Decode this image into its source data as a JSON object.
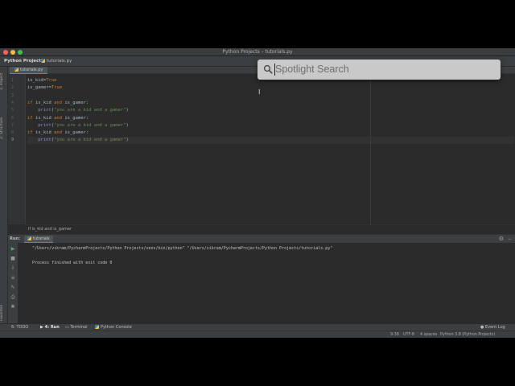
{
  "window": {
    "title": "Python Projects – tutorials.py",
    "traffic_colors": [
      "#fc615d",
      "#fdbc40",
      "#34c84a"
    ]
  },
  "navbar": {
    "project": "Python Projects",
    "file": "tutorials.py"
  },
  "left_strip": {
    "project_label": "1: Project",
    "structure_label": "Z: Structure",
    "favorites_label": "2: Favorites"
  },
  "editor": {
    "tab_label": "tutorials.py",
    "line_numbers": [
      "1",
      "2",
      "3",
      "4",
      "5",
      "6",
      "7",
      "8",
      "9"
    ],
    "current_line": 9,
    "lines": [
      [
        {
          "t": "is_kid=",
          "c": "plain"
        },
        {
          "t": "True",
          "c": "kw"
        }
      ],
      [
        {
          "t": "is_gamer=",
          "c": "plain"
        },
        {
          "t": "True",
          "c": "kw"
        }
      ],
      [],
      [
        {
          "t": "if ",
          "c": "kw"
        },
        {
          "t": "is_kid ",
          "c": "plain"
        },
        {
          "t": "and ",
          "c": "kw"
        },
        {
          "t": "is_gamer:",
          "c": "plain"
        }
      ],
      [
        {
          "t": "    ",
          "c": "plain"
        },
        {
          "t": "print",
          "c": "fn"
        },
        {
          "t": "(",
          "c": "plain"
        },
        {
          "t": "\"you are a kid and a gamer\"",
          "c": "st"
        },
        {
          "t": ")",
          "c": "plain"
        }
      ],
      [
        {
          "t": "if ",
          "c": "kw"
        },
        {
          "t": "is_kid ",
          "c": "plain"
        },
        {
          "t": "and ",
          "c": "kw"
        },
        {
          "t": "is_gamer:",
          "c": "plain"
        }
      ],
      [
        {
          "t": "    ",
          "c": "plain"
        },
        {
          "t": "print",
          "c": "fn"
        },
        {
          "t": "(",
          "c": "plain"
        },
        {
          "t": "\"you are a kid and a gamer\"",
          "c": "st"
        },
        {
          "t": ")",
          "c": "plain"
        }
      ],
      [
        {
          "t": "if ",
          "c": "kw"
        },
        {
          "t": "is_kid ",
          "c": "plain"
        },
        {
          "t": "and ",
          "c": "kw"
        },
        {
          "t": "is_gamer:",
          "c": "plain"
        }
      ],
      [
        {
          "t": "    ",
          "c": "plain"
        },
        {
          "t": "print",
          "c": "fn"
        },
        {
          "t": "(",
          "c": "plain"
        },
        {
          "t": "\"you are a kid and a gamer\"",
          "c": "st"
        },
        {
          "t": ")",
          "c": "plain"
        }
      ]
    ],
    "breadcrumb": "if is_kid and is_gamer"
  },
  "run_panel": {
    "label": "Run:",
    "tab": "tutorials",
    "command": "\"/Users/vikram/PycharmProjects/Python Projects/venv/bin/python\" \"/Users/vikram/PycharmProjects/Python Projects/tutorials.py\"",
    "result": "Process finished with exit code 0"
  },
  "bottom_tabs": {
    "todo": "6: TODO",
    "run": "4: Run",
    "terminal": "Terminal",
    "python_console": "Python Console",
    "event_log": "Event Log"
  },
  "statusbar": {
    "position": "9:38",
    "encoding": "UTF-8",
    "indent": "4 spaces",
    "interpreter": "Python 3.8 (Python Projects)"
  },
  "spotlight": {
    "placeholder": "Spotlight Search"
  }
}
